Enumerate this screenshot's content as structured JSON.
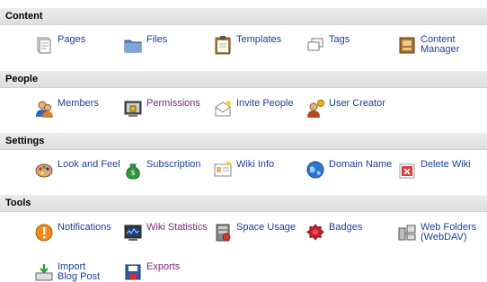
{
  "sections": {
    "content": {
      "title": "Content",
      "items": {
        "pages": "Pages",
        "files": "Files",
        "templates": "Templates",
        "tags": "Tags",
        "content_manager_1": "Content",
        "content_manager_2": "Manager"
      }
    },
    "people": {
      "title": "People",
      "items": {
        "members": "Members",
        "permissions": "Permissions",
        "invite": "Invite People",
        "user_creator": "User Creator"
      }
    },
    "settings": {
      "title": "Settings",
      "items": {
        "look_and_feel": "Look and Feel",
        "subscription": "Subscription",
        "wiki_info": "Wiki Info",
        "domain_name": "Domain Name",
        "delete_wiki": "Delete Wiki"
      }
    },
    "tools": {
      "title": "Tools",
      "items": {
        "notifications": "Notifications",
        "wiki_statistics": "Wiki Statistics",
        "space_usage": "Space Usage",
        "badges": "Badges",
        "web_folders_1": "Web Folders",
        "web_folders_2": "(WebDAV)",
        "import_1": "Import",
        "import_2": "Blog Post",
        "exports": "Exports"
      }
    }
  },
  "colors": {
    "link": "#1a3f9c",
    "visited_link": "#7a2a7a",
    "header_bg": "#e4e4e4"
  }
}
